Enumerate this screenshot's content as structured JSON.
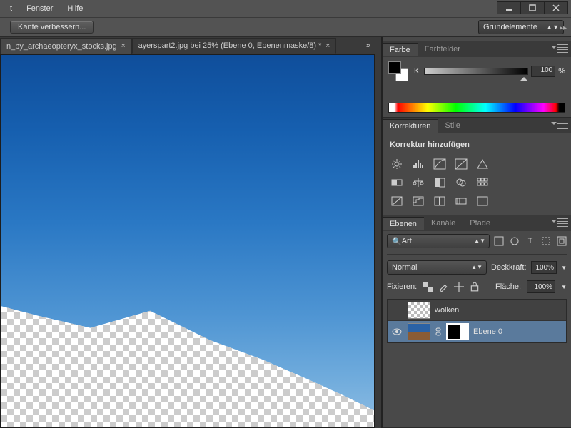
{
  "menu": {
    "fenster": "Fenster",
    "hilfe": "Hilfe",
    "partial": "t"
  },
  "optionsbar": {
    "refine": "Kante verbessern..."
  },
  "workspace": {
    "name": "Grundelemente"
  },
  "tabs": {
    "t1": "n_by_archaeopteryx_stocks.jpg",
    "t2": "ayerspart2.jpg bei 25% (Ebene 0, Ebenenmaske/8) *"
  },
  "color_panel": {
    "tab_color": "Farbe",
    "tab_swatches": "Farbfelder",
    "channel": "K",
    "value": "100",
    "unit": "%"
  },
  "adjust_panel": {
    "tab_korr": "Korrekturen",
    "tab_stile": "Stile",
    "title": "Korrektur hinzufügen"
  },
  "layers_panel": {
    "tab_ebenen": "Ebenen",
    "tab_kanale": "Kanäle",
    "tab_pfade": "Pfade",
    "search_label": "Art",
    "blend": "Normal",
    "opacity_label": "Deckkraft:",
    "opacity_val": "100%",
    "lock_label": "Fixieren:",
    "fill_label": "Fläche:",
    "fill_val": "100%",
    "layers": [
      {
        "name": "wolken"
      },
      {
        "name": "Ebene 0"
      }
    ]
  }
}
